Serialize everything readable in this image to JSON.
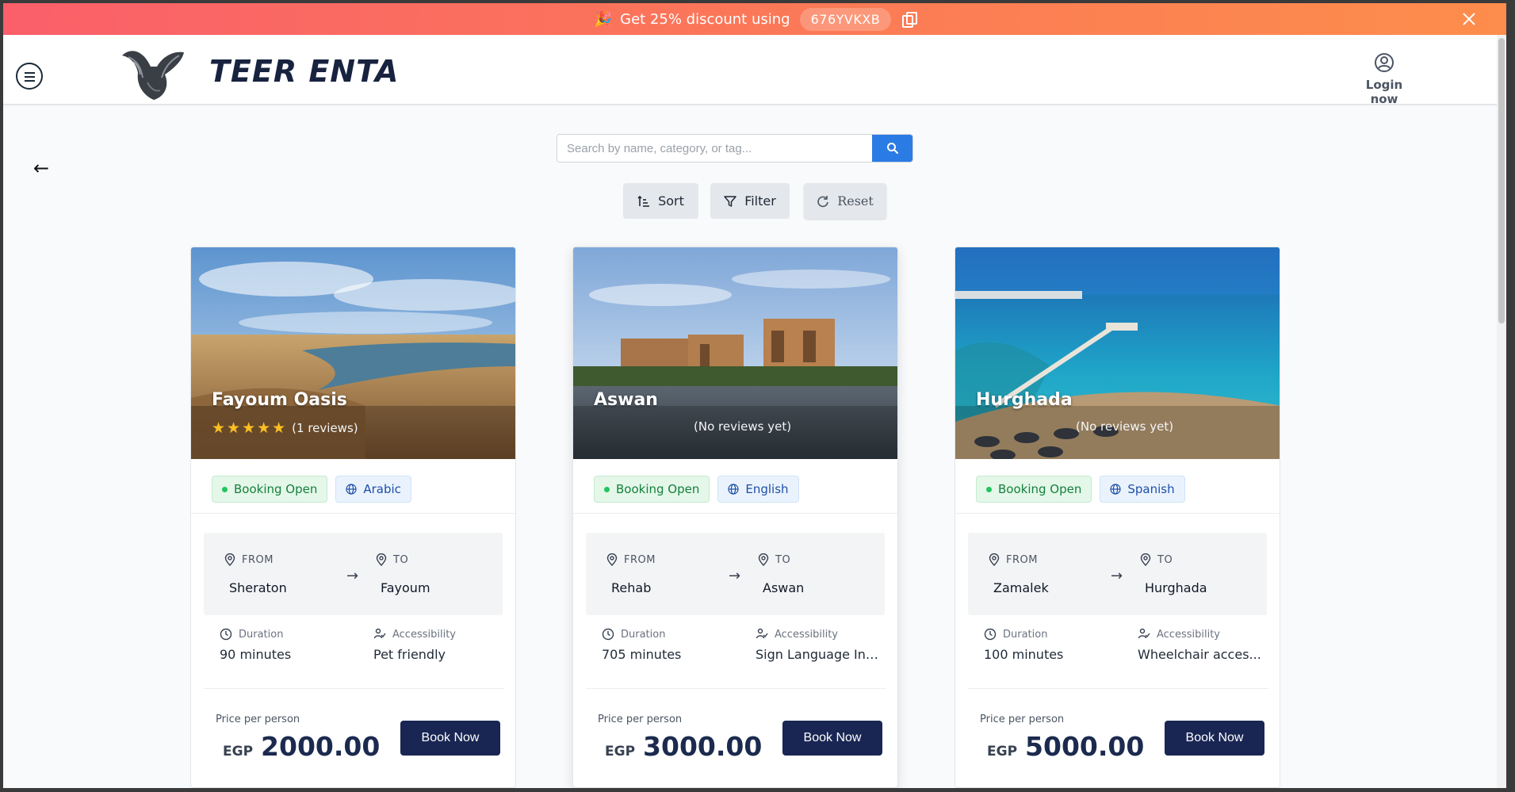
{
  "promo": {
    "message": "Get 25% discount using",
    "code": "676YVKXB"
  },
  "header": {
    "brand": "TEER ENTA",
    "login_label": "Login now"
  },
  "search": {
    "placeholder": "Search by name, category, or tag..."
  },
  "toolbar": {
    "sort_label": "Sort",
    "filter_label": "Filter",
    "reset_label": "Reset"
  },
  "cards": [
    {
      "title": "Fayoum Oasis",
      "rating": 5,
      "stars": "★★★★★",
      "reviews": "(1 reviews)",
      "status": "Booking Open",
      "language": "Arabic",
      "from_label": "FROM",
      "from": "Sheraton",
      "to_label": "TO",
      "to": "Fayoum",
      "duration_label": "Duration",
      "duration": "90 minutes",
      "accessibility_label": "Accessibility",
      "accessibility": "Pet friendly",
      "price_label": "Price per person",
      "currency": "EGP",
      "price": "2000.00",
      "book_label": "Book Now"
    },
    {
      "title": "Aswan",
      "rating": 0,
      "stars": "",
      "reviews": "(No reviews yet)",
      "status": "Booking Open",
      "language": "English",
      "from_label": "FROM",
      "from": "Rehab",
      "to_label": "TO",
      "to": "Aswan",
      "duration_label": "Duration",
      "duration": "705 minutes",
      "accessibility_label": "Accessibility",
      "accessibility": "Sign Language Int...",
      "price_label": "Price per person",
      "currency": "EGP",
      "price": "3000.00",
      "book_label": "Book Now"
    },
    {
      "title": "Hurghada",
      "rating": 0,
      "stars": "",
      "reviews": "(No reviews yet)",
      "status": "Booking Open",
      "language": "Spanish",
      "from_label": "FROM",
      "from": "Zamalek",
      "to_label": "TO",
      "to": "Hurghada",
      "duration_label": "Duration",
      "duration": "100 minutes",
      "accessibility_label": "Accessibility",
      "accessibility": "Wheelchair acces...",
      "price_label": "Price per person",
      "currency": "EGP",
      "price": "5000.00",
      "book_label": "Book Now"
    }
  ],
  "colors": {
    "promo_start": "#fa5f6a",
    "promo_end": "#fd8d4c",
    "brand_text": "#18233f",
    "search_button": "#2b7be4",
    "book_button": "#192653",
    "open_badge_bg": "#e4f7e9",
    "lang_badge_bg": "#eaf3fd",
    "star": "#fbbf24"
  },
  "icons": {
    "promo": "party-popper-icon",
    "copy": "copy-icon",
    "close": "close-icon",
    "menu": "hamburger-menu-icon",
    "user": "user-circle-icon",
    "back": "arrow-left-icon",
    "search": "search-icon",
    "sort": "sort-ascending-icon",
    "filter": "filter-funnel-icon",
    "reset": "refresh-icon",
    "language": "globe-icon",
    "location": "map-pin-icon",
    "route": "arrow-right-icon",
    "duration": "clock-icon",
    "accessibility": "accessibility-person-icon"
  }
}
